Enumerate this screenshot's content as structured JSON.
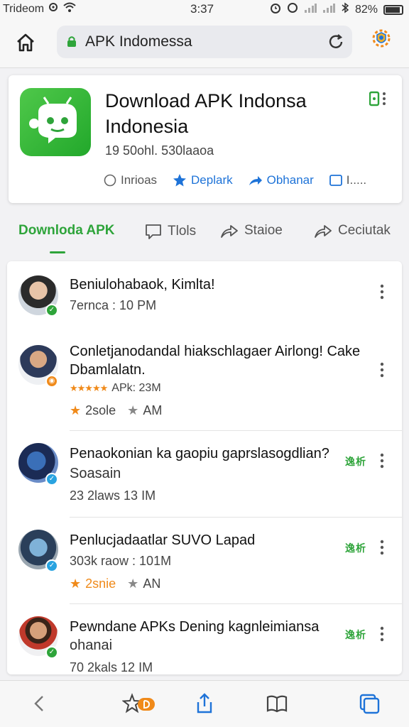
{
  "status_bar": {
    "carrier": "Trideom",
    "time": "3:37",
    "battery": "82%"
  },
  "browser": {
    "url": "APK Indomessa"
  },
  "app": {
    "title": "Download APK Indonsa Indonesia",
    "meta": "19 50ohl. 530laaoa",
    "actions": [
      {
        "label": "Inrioas",
        "icon": "radio-icon"
      },
      {
        "label": "Deplark",
        "icon": "star-icon"
      },
      {
        "label": "Obhanar",
        "icon": "share-icon"
      },
      {
        "label": "I.....",
        "icon": "checkbox-icon"
      }
    ]
  },
  "tabs": [
    {
      "label": "Downloda APK",
      "active": true
    },
    {
      "label": "Tlols",
      "icon": "comment-icon"
    },
    {
      "label": "Staioe",
      "icon": "share-icon"
    },
    {
      "label": "Ceciutak",
      "icon": "share-icon"
    }
  ],
  "feed": [
    {
      "title": "Beniulohabaok, Kimlta!",
      "sub": "7ernca : 10 PM",
      "badge_color": "#2ea43a"
    },
    {
      "title": "Conletjanodandal hiakschlagaer Airlong! Cake",
      "title2": "Dbamlalatn.",
      "sub": "APk: 23M",
      "rating": "★★★★★",
      "line3_a": "2sole",
      "line3_b": "AM",
      "badge_color": "#f08a1a"
    },
    {
      "title": "Penaokonian ka gaopiu gaprslasogdlian?",
      "title2": "Soasain",
      "sub": "23 2laws 13 IM",
      "tag": "逸析",
      "badge_color": "#29a3e0"
    },
    {
      "title": "Penlucjadaatlar SUVO Lapad",
      "sub": "303k raow : 101M",
      "line3_a": "2snie",
      "line3_b": "AN",
      "tag": "逸析",
      "badge_color": "#29a3e0"
    },
    {
      "title": "Pewndane APKs Dening kagnleimiansa",
      "title2": "ohanai",
      "sub": "70 2kals 12 IM",
      "tag": "逸析",
      "badge_color": "#2ea43a"
    }
  ]
}
